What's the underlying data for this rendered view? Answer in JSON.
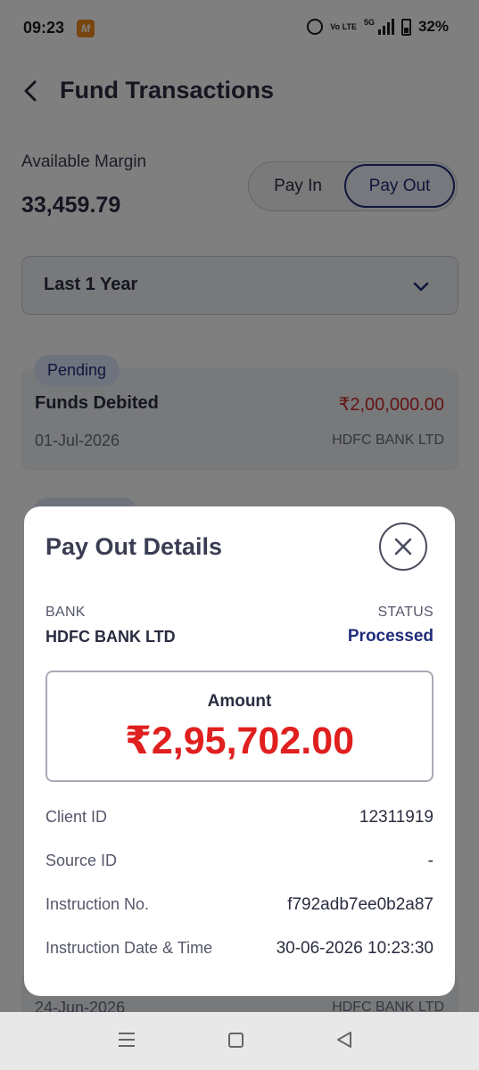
{
  "status_bar": {
    "time": "09:23",
    "app_icon_letter": "M",
    "network_label": "5G",
    "volte_label": "Vo LTE",
    "battery": "32%"
  },
  "header": {
    "title": "Fund Transactions"
  },
  "margin": {
    "label": "Available Margin",
    "value": "33,459.79"
  },
  "tabs": {
    "pay_in": "Pay In",
    "pay_out": "Pay Out",
    "selected": "Pay Out"
  },
  "filter": {
    "period": "Last 1 Year"
  },
  "transactions": [
    {
      "badge": "Pending",
      "title": "Funds Debited",
      "amount": "₹2,00,000.00",
      "date": "01-Jul-2026",
      "bank": "HDFC BANK LTD"
    },
    {
      "date": "24-Jun-2026",
      "bank": "HDFC BANK LTD"
    }
  ],
  "modal": {
    "title": "Pay Out Details",
    "bank_label": "BANK",
    "bank_value": "HDFC BANK LTD",
    "status_label": "STATUS",
    "status_value": "Processed",
    "amount_label": "Amount",
    "amount_value": "₹2,95,702.00",
    "details": [
      {
        "key": "Client ID",
        "value": "12311919"
      },
      {
        "key": "Source ID",
        "value": "-"
      },
      {
        "key": "Instruction No.",
        "value": "f792adb7ee0b2a87"
      },
      {
        "key": "Instruction Date & Time",
        "value": "30-06-2026 10:23:30"
      }
    ]
  },
  "colors": {
    "brand_navy": "#1f2d7a",
    "debit_red": "#c62828",
    "amount_red": "#e01f1f"
  }
}
